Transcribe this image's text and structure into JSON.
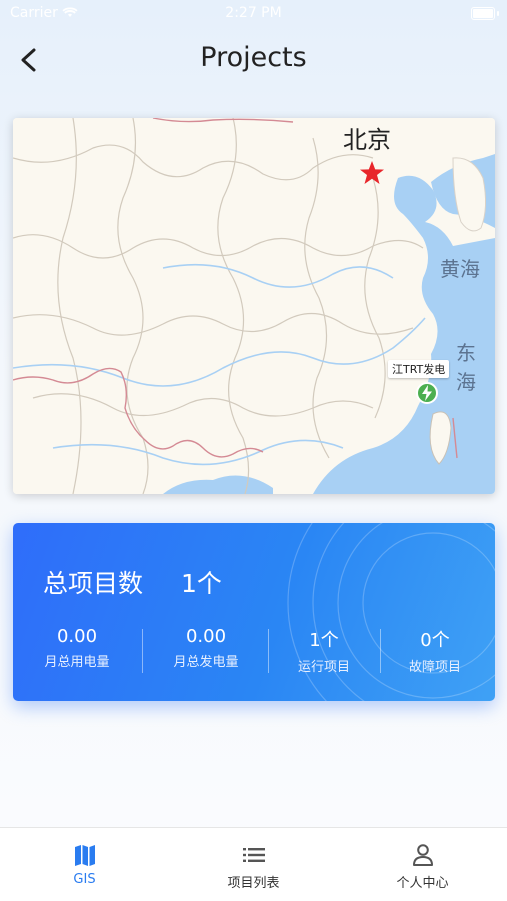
{
  "status_bar": {
    "carrier": "Carrier",
    "time": "2:27 PM"
  },
  "nav": {
    "title": "Projects",
    "back_icon": "chevron-left-icon"
  },
  "map": {
    "city_label": "北京",
    "sea_label_1": "黄海",
    "sea_label_2": "东海",
    "project_marker_label": "江TRT发电",
    "marker_icon": "lightning-icon",
    "colors": {
      "land": "#fbf8f0",
      "water": "#a8d0f4",
      "border": "#d9d2c8",
      "star": "#e8262b",
      "marker": "#4caf50"
    }
  },
  "stats": {
    "total_label": "总项目数",
    "total_value": "1个",
    "items": [
      {
        "value": "0.00",
        "label": "月总用电量"
      },
      {
        "value": "0.00",
        "label": "月总发电量"
      },
      {
        "value": "1个",
        "label": "运行项目"
      },
      {
        "value": "0个",
        "label": "故障项目"
      }
    ],
    "colors": {
      "gradient_start": "#2f6dfa",
      "gradient_end": "#3fa1f5"
    }
  },
  "tabs": [
    {
      "label": "GIS",
      "icon": "map-icon",
      "active": true
    },
    {
      "label": "项目列表",
      "icon": "list-icon",
      "active": false
    },
    {
      "label": "个人中心",
      "icon": "person-icon",
      "active": false
    }
  ],
  "accent_color": "#2a7cf0"
}
